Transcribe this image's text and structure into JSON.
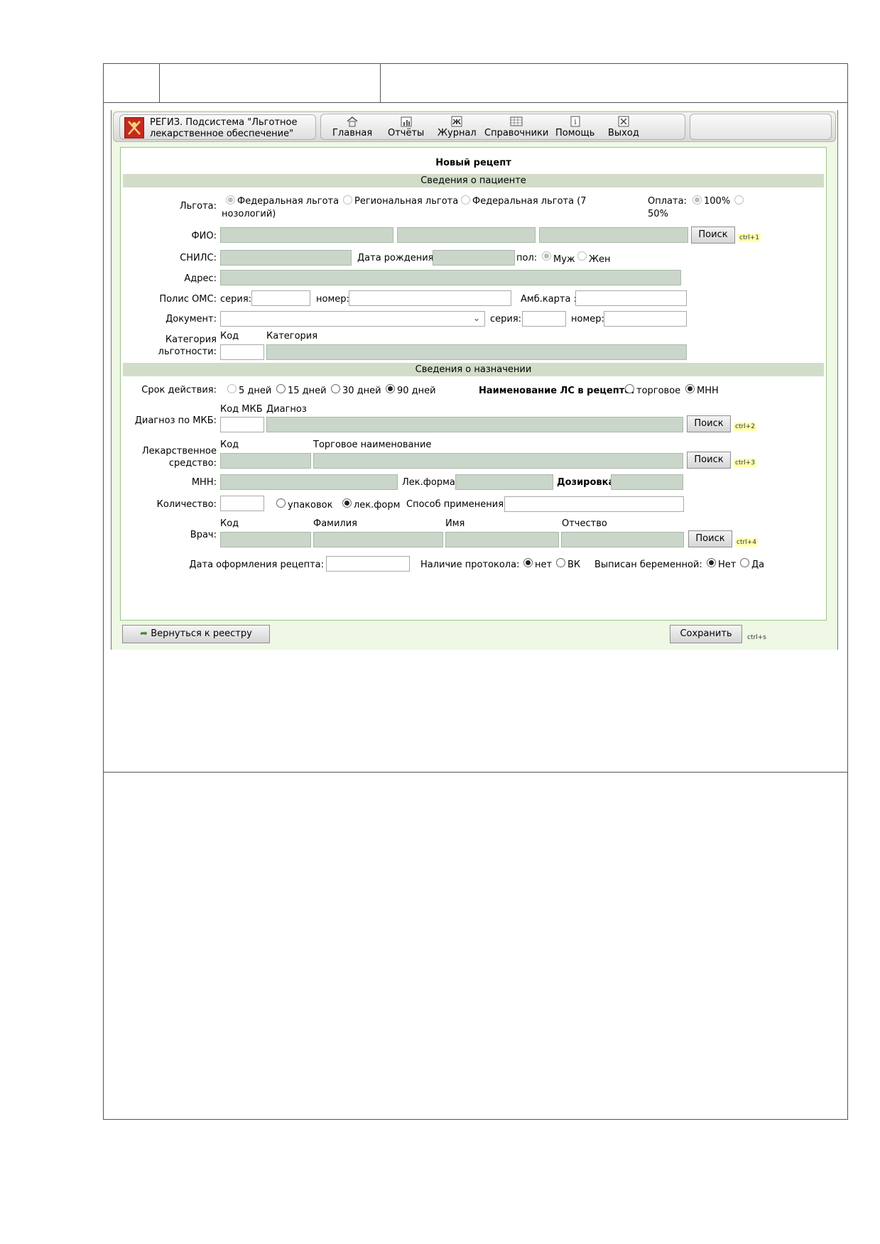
{
  "app": {
    "brand_line1": "РЕГИЗ. Подсистема \"Льготное",
    "brand_line2": "лекарственное обеспечение\"",
    "menu": {
      "home": "Главная",
      "reports": "Отчёты",
      "journal": "Журнал",
      "references": "Справочники",
      "help": "Помощь",
      "exit": "Выход"
    }
  },
  "form": {
    "title": "Новый рецепт",
    "section_patient": "Сведения о пациенте",
    "section_prescription": "Сведения о назначении",
    "benefit": {
      "label": "Льгота:",
      "opt_federal": "Федеральная льгота",
      "opt_regional": "Региональная льгота",
      "opt_federal7_a": "Федеральная льгота (7",
      "opt_federal7_b": "нозологий)",
      "selected": "Федеральная льгота"
    },
    "payment": {
      "label": "Оплата:",
      "opt_100": "100%",
      "opt_50": "50%",
      "selected": "100%"
    },
    "fio": {
      "label": "ФИО:",
      "search": "Поиск",
      "hotkey": "ctrl+1"
    },
    "snils": {
      "label": "СНИЛС:"
    },
    "birth_date": {
      "label": "Дата рождения:"
    },
    "gender": {
      "label": "пол:",
      "male": "Муж",
      "female": "Жен",
      "selected": "Муж"
    },
    "address": {
      "label": "Адрес:"
    },
    "oms": {
      "label": "Полис ОМС:",
      "series": "серия:",
      "number": "номер:",
      "amb_card": "Амб.карта :"
    },
    "document": {
      "label": "Документ:",
      "series": "серия:",
      "number": "номер:"
    },
    "category": {
      "label_a": "Категория",
      "label_b": "льготности:",
      "col_code": "Код",
      "col_category": "Категория"
    },
    "validity": {
      "label": "Срок действия:",
      "opt_5": "5 дней",
      "opt_15": "15 дней",
      "opt_30": "30 дней",
      "opt_90": "90 дней",
      "selected": "90 дней"
    },
    "drug_name_type": {
      "label": "Наименование ЛС в рецепте:",
      "opt_trade": "торговое",
      "opt_mnn": "МНН",
      "selected": "МНН"
    },
    "diagnosis": {
      "label": "Диагноз по МКБ:",
      "col_code": "Код МКБ",
      "col_diagnosis": "Диагноз",
      "search": "Поиск",
      "hotkey": "ctrl+2"
    },
    "drug": {
      "label_a": "Лекарственное",
      "label_b": "средство:",
      "col_code": "Код",
      "col_trade": "Торговое наименование",
      "search": "Поиск",
      "hotkey": "ctrl+3"
    },
    "mnn": {
      "label": "МНН:",
      "form": "Лек.форма:",
      "dosage": "Дозировка:"
    },
    "quantity": {
      "label": "Количество:",
      "opt_packs": "упаковок",
      "opt_forms": "лек.форм",
      "selected": "лек.форм",
      "usage": "Способ применения:"
    },
    "doctor": {
      "label": "Врач:",
      "col_code": "Код",
      "col_last": "Фамилия",
      "col_first": "Имя",
      "col_middle": "Отчество",
      "search": "Поиск",
      "hotkey": "ctrl+4"
    },
    "issue_date": {
      "label": "Дата оформления рецепта:"
    },
    "protocol": {
      "label": "Наличие протокола:",
      "opt_no": "нет",
      "opt_vk": "ВК",
      "selected": "нет"
    },
    "pregnant": {
      "label": "Выписан беременной:",
      "opt_no": "Нет",
      "opt_yes": "Да",
      "selected": "Нет"
    }
  },
  "footer": {
    "back": "Вернуться к реестру",
    "save": "Сохранить",
    "save_hotkey": "ctrl+s"
  }
}
